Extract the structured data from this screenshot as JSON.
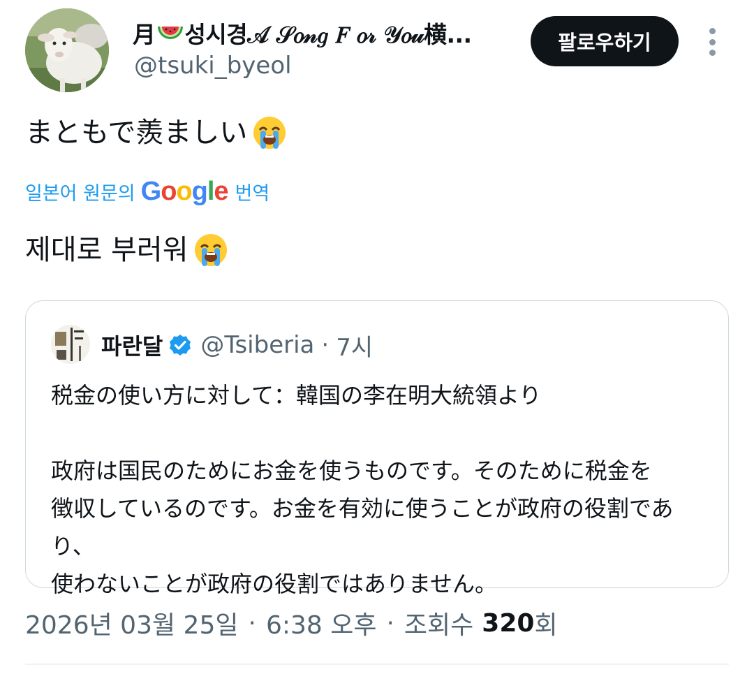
{
  "author": {
    "name_prefix": "月",
    "name_suffix": "성시경𝒜 𝒮𝑜𝓃𝑔 𝐹 𝑜𝓇 𝒴𝑜𝓊横...",
    "name_icon": "watermelon-icon",
    "handle": "@tsuki_byeol",
    "follow_label": "팔로우하기"
  },
  "tweet": {
    "text": "まともで羨ましい",
    "emoji": "loudly-crying-face",
    "translate_prefix": "일본어 원문의",
    "translate_brand": [
      "G",
      "o",
      "o",
      "g",
      "l",
      "e"
    ],
    "translate_suffix": "번역",
    "translated_text": "제대로 부러워"
  },
  "quote": {
    "name": "파란달",
    "verified": true,
    "handle": "@Tsiberia",
    "separator": "·",
    "time": "7시",
    "line1": "税金の使い方に対して：韓国の李在明大統領より",
    "line2": "政府は国民のためにお金を使うものです。そのために税金を",
    "line3": "徴収しているのです。お金を有効に使うことが政府の役割であり、",
    "line4": "使わないことが政府の役割ではありません。"
  },
  "meta": {
    "date": "2026년 03월 25일",
    "time": "6:38 오후",
    "separator": "·",
    "views_label": "조회수",
    "views_count": "320",
    "views_suffix": "회"
  },
  "colors": {
    "text": "#0f1419",
    "secondary": "#536471",
    "link": "#1d9bf0",
    "verified": "#1d9bf0",
    "border": "#cfd9de",
    "google_blue": "#4285F4",
    "google_red": "#EA4335",
    "google_yellow": "#FBBC05",
    "google_green": "#34A853"
  }
}
